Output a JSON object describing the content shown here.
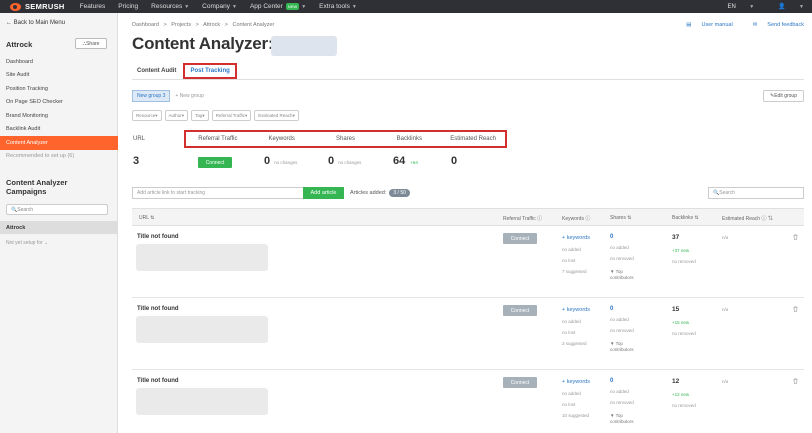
{
  "topbar": {
    "brand": "SEMRUSH",
    "nav": [
      {
        "label": "Features",
        "has_menu": false
      },
      {
        "label": "Pricing",
        "has_menu": false
      },
      {
        "label": "Resources",
        "has_menu": true
      },
      {
        "label": "Company",
        "has_menu": true
      },
      {
        "label": "App Center",
        "has_menu": true,
        "badge": "NEW"
      },
      {
        "label": "Extra tools",
        "has_menu": true
      }
    ],
    "lang": "EN"
  },
  "sidebar": {
    "back_label": "Back to Main Menu",
    "project": "Attrock",
    "share_label": "Share",
    "items": [
      {
        "label": "Dashboard"
      },
      {
        "label": "Site Audit"
      },
      {
        "label": "Position Tracking"
      },
      {
        "label": "On Page SEO Checker"
      },
      {
        "label": "Brand Monitoring"
      },
      {
        "label": "Backlink Audit"
      },
      {
        "label": "Content Analyzer"
      },
      {
        "label": "Recommended to set up (6)"
      }
    ],
    "campaigns_title": "Content Analyzer Campaigns",
    "search_placeholder": "Search",
    "selected_campaign": "Attrock",
    "setup_label": "Not yet setup for"
  },
  "main": {
    "breadcrumb": [
      "Dashboard",
      ">",
      "Projects",
      ">",
      "Attrock",
      ">",
      "Content Analyzer"
    ],
    "title": "Content Analyzer:",
    "user_manual": "User manual",
    "send_feedback": "Send feedback",
    "tabs": [
      {
        "label": "Content Audit"
      },
      {
        "label": "Post Tracking"
      }
    ],
    "group_tab": "New group 3",
    "new_group": "+ New group",
    "edit_group": "Edit group",
    "filters": [
      "Resource",
      "Author",
      "Tag",
      "Referral Traffic",
      "Estimated Reach"
    ],
    "summary": {
      "url_label": "URL",
      "url_count": "3",
      "headers": [
        "Referral Traffic",
        "Keywords",
        "Shares",
        "Backlinks",
        "Estimated Reach"
      ],
      "connect_label": "Connect",
      "keywords_value": "0",
      "keywords_note": "no changes",
      "shares_value": "0",
      "shares_note": "no changes",
      "backlinks_value": "64",
      "backlinks_note": "+64",
      "reach_value": "0"
    },
    "add_placeholder": "Add article link to start tracking",
    "add_button": "Add article",
    "articles_added_label": "Articles added:",
    "articles_added_count": "3 / 50",
    "search_placeholder": "Search",
    "table_headers": [
      "URL",
      "Referral Traffic",
      "Keywords",
      "Shares",
      "Backlinks",
      "Estimated Reach"
    ],
    "rows": [
      {
        "title": "Title not found",
        "connect": "Connect",
        "keywords": "+ keywords",
        "kw_added": "no added",
        "kw_lost": "no lost",
        "kw_suggested": "7 suggested",
        "shares": "0",
        "sh_added": "no added",
        "sh_removed": "no removed",
        "top1": "Top",
        "top2": "contributors",
        "backlinks": "37",
        "bl_new": "+37 new",
        "bl_removed": "no removed",
        "reach": "n/a"
      },
      {
        "title": "Title not found",
        "connect": "Connect",
        "keywords": "+ keywords",
        "kw_added": "no added",
        "kw_lost": "no lost",
        "kw_suggested": "3 suggested",
        "shares": "0",
        "sh_added": "no added",
        "sh_removed": "no removed",
        "top1": "Top",
        "top2": "contributors",
        "backlinks": "15",
        "bl_new": "+15 new",
        "bl_removed": "no removed",
        "reach": "n/a"
      },
      {
        "title": "Title not found",
        "connect": "Connect",
        "keywords": "+ keywords",
        "kw_added": "no added",
        "kw_lost": "no lost",
        "kw_suggested": "10 suggested",
        "shares": "0",
        "sh_added": "no added",
        "sh_removed": "no removed",
        "top1": "Top",
        "top2": "contributors",
        "backlinks": "12",
        "bl_new": "+12 new",
        "bl_removed": "no removed",
        "reach": "n/a"
      }
    ]
  },
  "colors": {
    "brand": "#ff642d",
    "accent": "#2c79c6",
    "success": "#35b653",
    "highlight": "#d32f2f"
  }
}
